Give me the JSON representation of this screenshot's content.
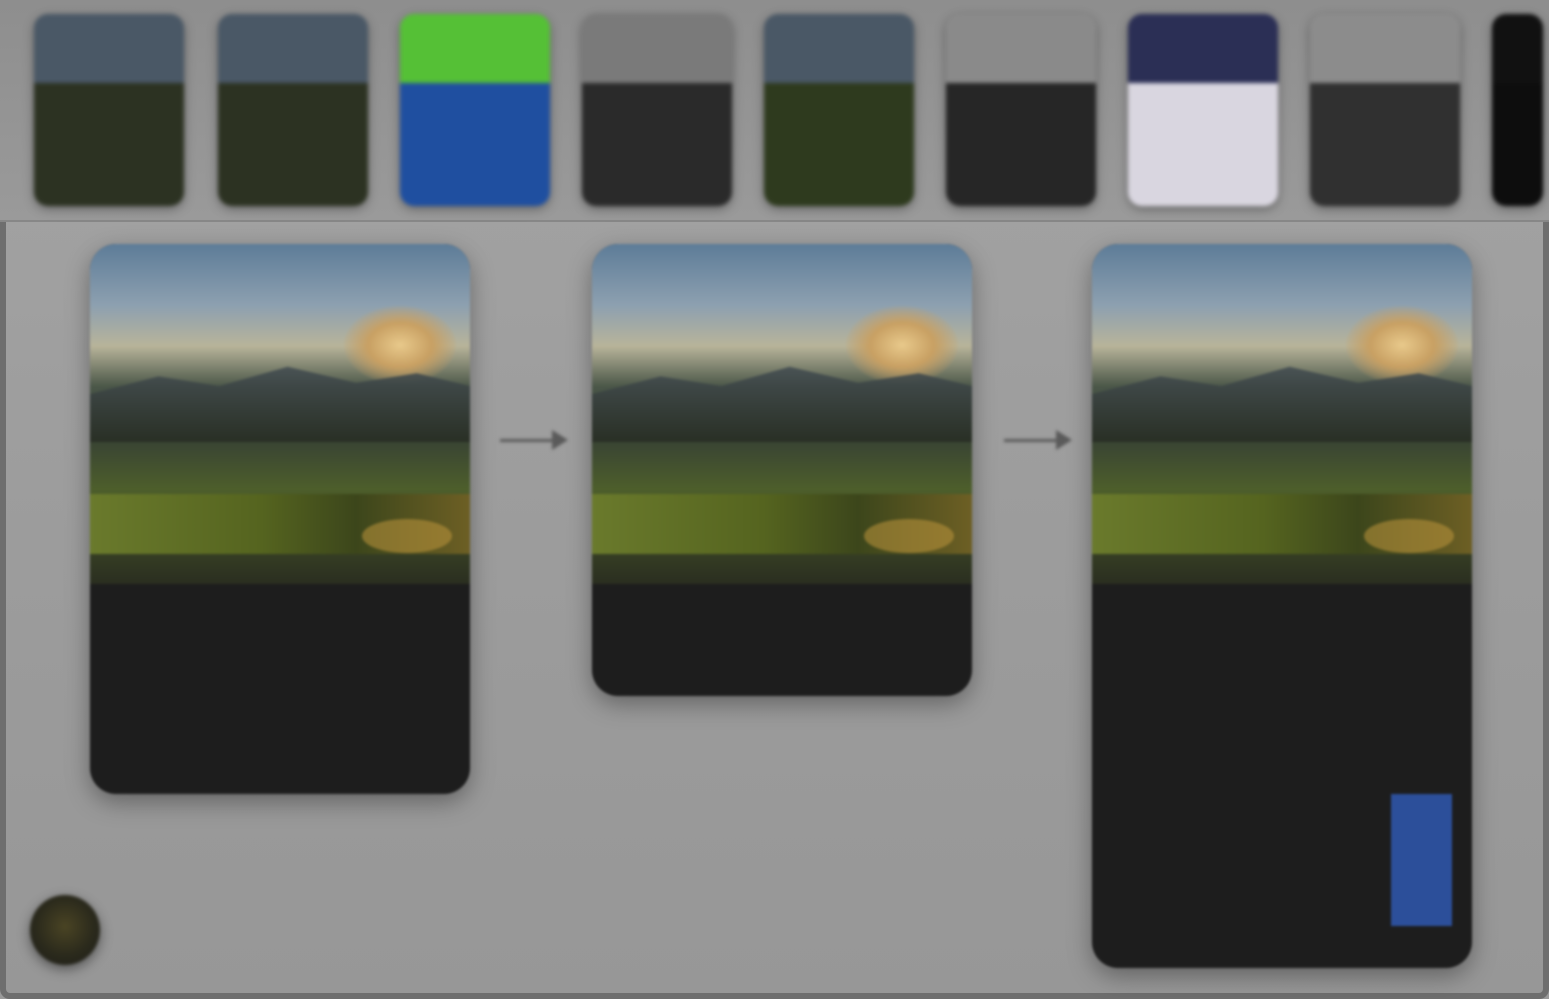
{
  "filmstrip": {
    "thumbnails": [
      {
        "label": "",
        "sky": "#4a5866",
        "land": "#2c3222"
      },
      {
        "label": "",
        "sky": "#4a5866",
        "land": "#2c3222"
      },
      {
        "label": "",
        "sky": "#55c036",
        "land": "#1f4fa0"
      },
      {
        "label": "",
        "sky": "#7a7a7a",
        "land": "#2a2a2a"
      },
      {
        "label": "",
        "sky": "#4a5866",
        "land": "#2e3a1e"
      },
      {
        "label": "",
        "sky": "#8a8a8a",
        "land": "#262626"
      },
      {
        "label": "",
        "sky": "#2b2f55",
        "land": "#d9d6e0"
      },
      {
        "label": "",
        "sky": "#8c8c8c",
        "land": "#303030"
      },
      {
        "label": "",
        "sky": "#111111",
        "land": "#0d0d0d"
      }
    ]
  },
  "cards": [
    {
      "header": "",
      "rows": [
        {
          "key": "",
          "value": ""
        },
        {
          "key": "",
          "value": ""
        },
        {
          "key": "",
          "value": ""
        }
      ]
    },
    {
      "header": "",
      "rows": [
        {
          "key": "",
          "value": ""
        }
      ]
    },
    {
      "header": "",
      "rows": [
        {
          "key": "",
          "value": ""
        },
        {
          "key": "",
          "value": ""
        },
        {
          "key": "",
          "value": ""
        },
        {
          "key": "",
          "value": ""
        },
        {
          "key": "",
          "value": ""
        },
        {
          "key": "",
          "value": ""
        },
        {
          "key": "",
          "value": ""
        }
      ]
    }
  ],
  "colors": {
    "background": "#9a9a9a",
    "card": "#1d1d1d",
    "accent": "#c9a83b",
    "highlight": "#2c4f9a"
  },
  "icons": {
    "corner_button": "photo-thumbnail-icon",
    "connector": "arrow-right-icon"
  }
}
